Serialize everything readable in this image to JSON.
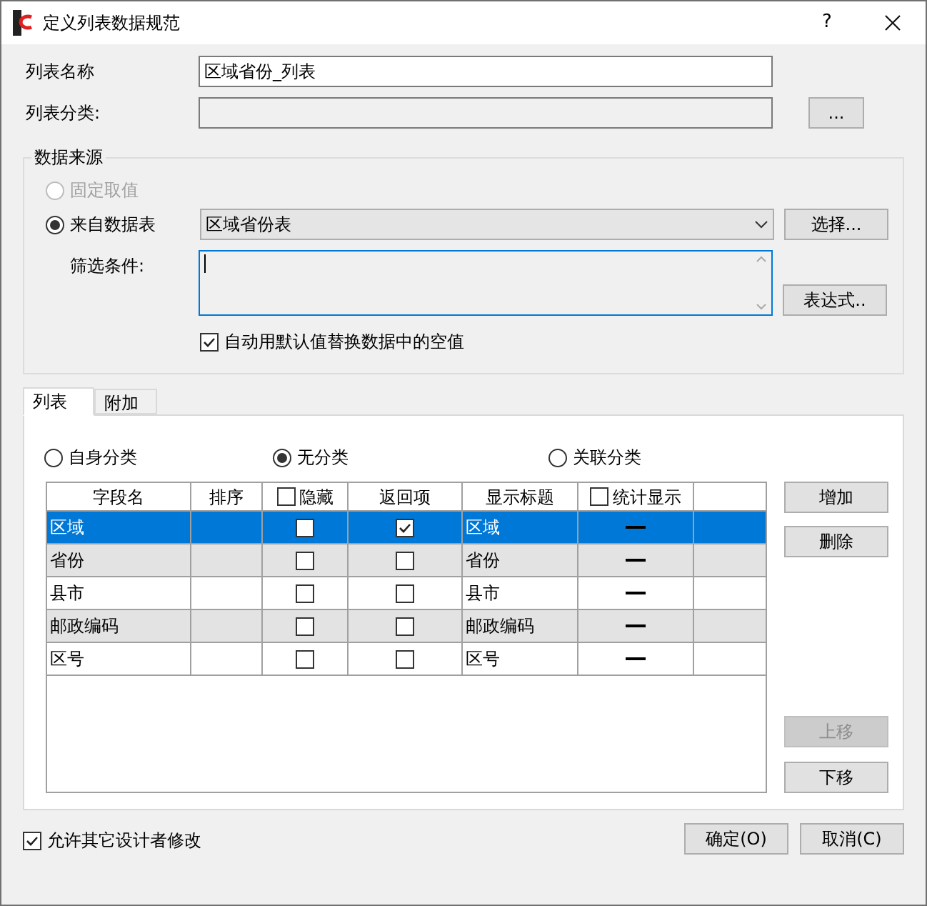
{
  "window": {
    "title": "定义列表数据规范",
    "help": "?"
  },
  "list_name": {
    "label": "列表名称",
    "value": "区域省份_列表"
  },
  "list_category": {
    "label": "列表分类:",
    "browse": "...",
    "disabled": true
  },
  "data_source": {
    "title": "数据来源",
    "options": [
      {
        "label": "固定取值",
        "selected": false,
        "disabled": true
      },
      {
        "label": "来自数据表",
        "selected": true,
        "disabled": false
      }
    ],
    "table": {
      "value": "区域省份表"
    },
    "select_button": "选择...",
    "filter": {
      "label": "筛选条件:"
    },
    "expression_button": "表达式..",
    "default_replace": {
      "label": "自动用默认值替换数据中的空值",
      "checked": true
    }
  },
  "tabs": [
    {
      "label": "列表",
      "selected": true
    },
    {
      "label": "附加",
      "selected": false
    }
  ],
  "classification": [
    {
      "label": "自身分类",
      "selected": false
    },
    {
      "label": "无分类",
      "selected": true
    },
    {
      "label": "关联分类",
      "selected": false
    }
  ],
  "table": {
    "columns": [
      {
        "label": "字段名",
        "kind": "text"
      },
      {
        "label": "排序",
        "kind": "text"
      },
      {
        "label": "隐藏",
        "kind": "check",
        "checked": false
      },
      {
        "label": "返回项",
        "kind": "text"
      },
      {
        "label": "显示标题",
        "kind": "text"
      },
      {
        "label": "统计显示",
        "kind": "check",
        "checked": false
      }
    ],
    "rows": [
      {
        "field": "区域",
        "hidden": false,
        "returned": true,
        "title": "区域",
        "selected": true
      },
      {
        "field": "省份",
        "hidden": false,
        "returned": false,
        "title": "省份",
        "selected": false
      },
      {
        "field": "县市",
        "hidden": false,
        "returned": false,
        "title": "县市",
        "selected": false
      },
      {
        "field": "邮政编码",
        "hidden": false,
        "returned": false,
        "title": "邮政编码",
        "selected": false
      },
      {
        "field": "区号",
        "hidden": false,
        "returned": false,
        "title": "区号",
        "selected": false
      }
    ]
  },
  "side_buttons": [
    {
      "label": "增加",
      "disabled": false
    },
    {
      "label": "删除",
      "disabled": false
    },
    {
      "label": "上移",
      "disabled": true
    },
    {
      "label": "下移",
      "disabled": false
    }
  ],
  "allow_modify": {
    "label": "允许其它设计者修改",
    "checked": true
  },
  "ok_button": "确定(O)",
  "cancel_button": "取消(C)"
}
